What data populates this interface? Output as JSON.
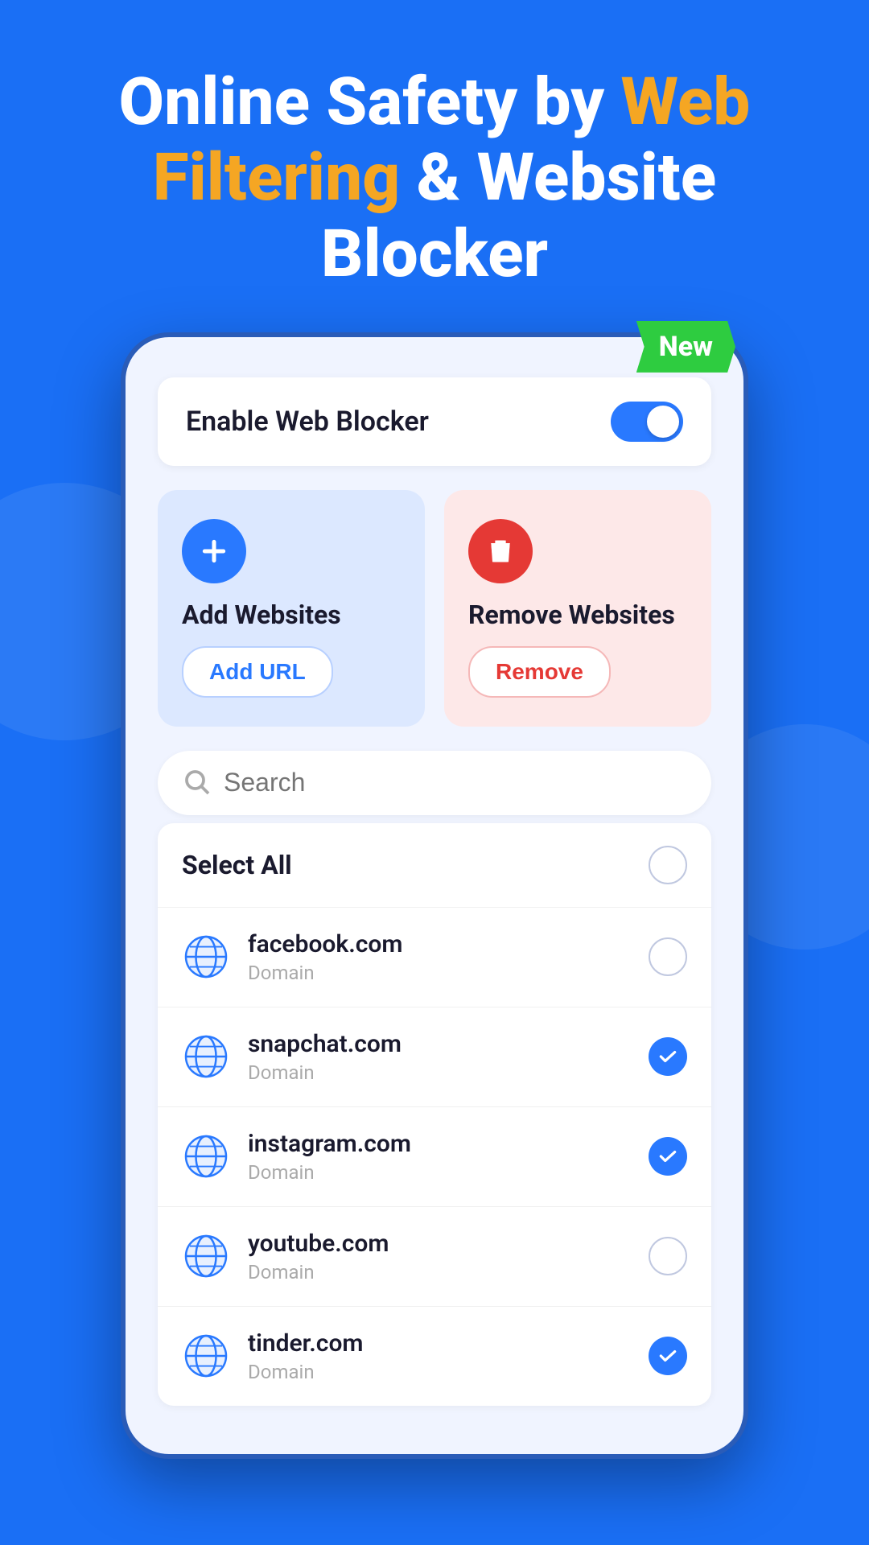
{
  "header": {
    "line1_white": "Online Safety by ",
    "line1_orange": "Web",
    "line2_orange": "Filtering",
    "line2_white": " & Website",
    "line3": "Blocker"
  },
  "badge": {
    "label": "New"
  },
  "enableRow": {
    "label": "Enable Web Blocker",
    "toggleOn": true
  },
  "cards": [
    {
      "id": "add",
      "title": "Add Websites",
      "button": "Add URL",
      "iconType": "plus"
    },
    {
      "id": "remove",
      "title": "Remove Websites",
      "button": "Remove",
      "iconType": "trash"
    }
  ],
  "search": {
    "placeholder": "Search"
  },
  "selectAll": {
    "label": "Select All",
    "checked": false
  },
  "websites": [
    {
      "domain": "facebook.com",
      "type": "Domain",
      "checked": false
    },
    {
      "domain": "snapchat.com",
      "type": "Domain",
      "checked": true
    },
    {
      "domain": "instagram.com",
      "type": "Domain",
      "checked": true
    },
    {
      "domain": "youtube.com",
      "type": "Domain",
      "checked": false
    },
    {
      "domain": "tinder.com",
      "type": "Domain",
      "checked": true
    }
  ]
}
